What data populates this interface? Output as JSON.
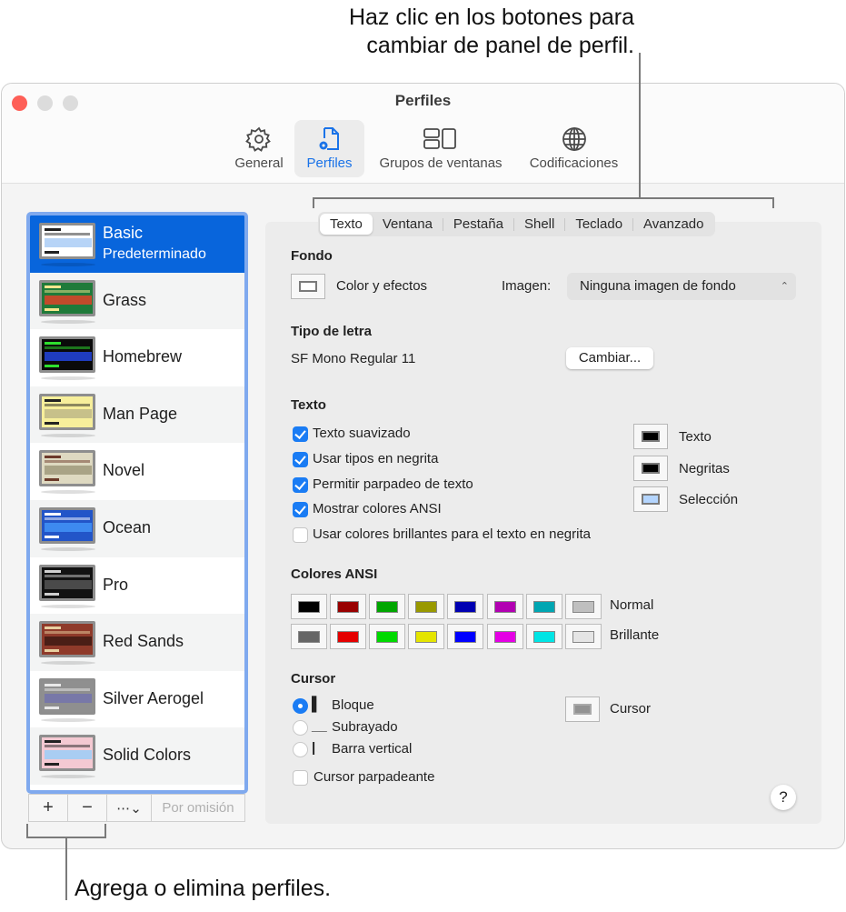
{
  "callouts": {
    "top_line1": "Haz clic en los botones para",
    "top_line2": "cambiar de panel de perfil.",
    "bottom": "Agrega o elimina perfiles."
  },
  "window": {
    "title": "Perfiles",
    "toolbar": [
      {
        "label": "General",
        "icon": "gear-icon",
        "active": false
      },
      {
        "label": "Perfiles",
        "icon": "profile-document-icon",
        "active": true
      },
      {
        "label": "Grupos de ventanas",
        "icon": "window-groups-icon",
        "active": false
      },
      {
        "label": "Codificaciones",
        "icon": "globe-icon",
        "active": false
      }
    ]
  },
  "profiles": {
    "items": [
      {
        "name": "Basic",
        "subtitle": "Predeterminado",
        "selected": true,
        "bg": "#ffffff",
        "fg": "#222222",
        "hl": "#b7d4f7"
      },
      {
        "name": "Grass",
        "bg": "#1f7a3a",
        "fg": "#f5e68e",
        "hl": "#c24a2b"
      },
      {
        "name": "Homebrew",
        "bg": "#0a0a0a",
        "fg": "#2ee02e",
        "hl": "#1f3cbf"
      },
      {
        "name": "Man Page",
        "bg": "#f7ef9b",
        "fg": "#222222",
        "hl": "#c7c08a"
      },
      {
        "name": "Novel",
        "bg": "#ded9c1",
        "fg": "#6b3a2a",
        "hl": "#a9a386"
      },
      {
        "name": "Ocean",
        "bg": "#2255c8",
        "fg": "#ffffff",
        "hl": "#3d8af0"
      },
      {
        "name": "Pro",
        "bg": "#121212",
        "fg": "#d0d0d0",
        "hl": "#4a4a4a"
      },
      {
        "name": "Red Sands",
        "bg": "#8f3a2a",
        "fg": "#e8cfa0",
        "hl": "#4a1e16"
      },
      {
        "name": "Silver Aerogel",
        "bg": "#8f8f8f",
        "fg": "#e8e8e8",
        "hl": "#7878a8"
      },
      {
        "name": "Solid Colors",
        "bg": "#f4c9d2",
        "fg": "#222222",
        "hl": "#a9cdf2"
      }
    ],
    "add_label": "+",
    "remove_label": "−",
    "more_label": "⋯⌄",
    "default_label": "Por omisión"
  },
  "tabs": [
    "Texto",
    "Ventana",
    "Pestaña",
    "Shell",
    "Teclado",
    "Avanzado"
  ],
  "active_tab": "Texto",
  "fondo": {
    "heading": "Fondo",
    "color_label": "Color y efectos",
    "image_label": "Imagen:",
    "image_value": "Ninguna imagen de fondo"
  },
  "font": {
    "heading": "Tipo de letra",
    "value": "SF Mono Regular 11",
    "change_button": "Cambiar..."
  },
  "text": {
    "heading": "Texto",
    "options": [
      {
        "label": "Texto suavizado",
        "checked": true
      },
      {
        "label": "Usar tipos en negrita",
        "checked": true
      },
      {
        "label": "Permitir parpadeo de texto",
        "checked": true
      },
      {
        "label": "Mostrar colores ANSI",
        "checked": true
      },
      {
        "label": "Usar colores brillantes para el texto en negrita",
        "checked": false
      }
    ],
    "colors": [
      {
        "label": "Texto",
        "color": "#000000"
      },
      {
        "label": "Negritas",
        "color": "#000000"
      },
      {
        "label": "Selección",
        "color": "#b4d5fe"
      }
    ]
  },
  "ansi": {
    "heading": "Colores ANSI",
    "normal_label": "Normal",
    "bright_label": "Brillante",
    "normal": [
      "#000000",
      "#990000",
      "#00a600",
      "#999900",
      "#0000b2",
      "#b200b2",
      "#00a6b2",
      "#bfbfbf"
    ],
    "bright": [
      "#666666",
      "#e50000",
      "#00d900",
      "#e5e500",
      "#0000ff",
      "#e500e5",
      "#00e5e5",
      "#e5e5e5"
    ]
  },
  "cursor": {
    "heading": "Cursor",
    "options": [
      {
        "label": "Bloque",
        "glyph": "▌",
        "selected": true
      },
      {
        "label": "Subrayado",
        "glyph": "__",
        "selected": false
      },
      {
        "label": "Barra vertical",
        "glyph": "|",
        "selected": false
      }
    ],
    "blink_label": "Cursor parpadeante",
    "blink_checked": false,
    "color_label": "Cursor",
    "color": "#929292"
  },
  "help_label": "?"
}
